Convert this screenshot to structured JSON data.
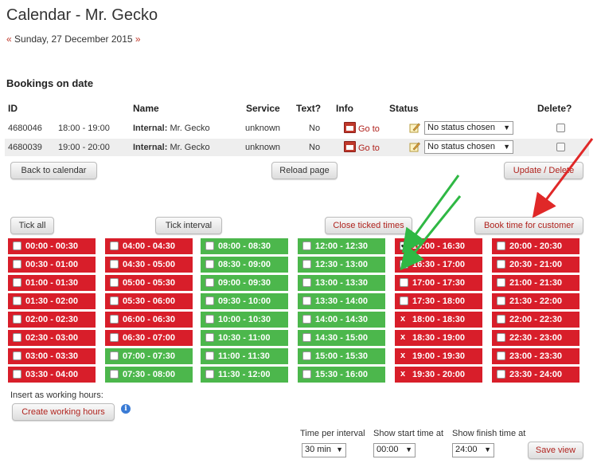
{
  "page": {
    "title": "Calendar - Mr. Gecko",
    "date_prev": "«",
    "date": "Sunday, 27 December 2015",
    "date_next": "»",
    "subtitle": "Bookings on date"
  },
  "table": {
    "headers": {
      "id": "ID",
      "name": "Name",
      "service": "Service",
      "text": "Text?",
      "info": "Info",
      "status": "Status",
      "delete": "Delete?"
    },
    "rows": [
      {
        "id": "4680046",
        "time": "18:00 - 19:00",
        "name_bold": "Internal:",
        "name": "Mr. Gecko",
        "service": "unknown",
        "text": "No",
        "info": "Go to",
        "status": "No status chosen"
      },
      {
        "id": "4680039",
        "time": "19:00 - 20:00",
        "name_bold": "Internal:",
        "name": "Mr. Gecko",
        "service": "unknown",
        "text": "No",
        "info": "Go to",
        "status": "No status chosen"
      }
    ]
  },
  "buttons": {
    "back": "Back to calendar",
    "reload": "Reload page",
    "update": "Update / Delete",
    "tick_all": "Tick all",
    "tick_interval": "Tick interval",
    "close_ticked": "Close ticked times",
    "book_time": "Book time for customer",
    "create_working": "Create working hours",
    "save_view": "Save view"
  },
  "slots": {
    "col1": [
      {
        "t": "00:00 - 00:30",
        "s": "closed"
      },
      {
        "t": "00:30 - 01:00",
        "s": "closed"
      },
      {
        "t": "01:00 - 01:30",
        "s": "closed"
      },
      {
        "t": "01:30 - 02:00",
        "s": "closed"
      },
      {
        "t": "02:00 - 02:30",
        "s": "closed"
      },
      {
        "t": "02:30 - 03:00",
        "s": "closed"
      },
      {
        "t": "03:00 - 03:30",
        "s": "closed"
      },
      {
        "t": "03:30 - 04:00",
        "s": "closed"
      }
    ],
    "col2": [
      {
        "t": "04:00 - 04:30",
        "s": "closed"
      },
      {
        "t": "04:30 - 05:00",
        "s": "closed"
      },
      {
        "t": "05:00 - 05:30",
        "s": "closed"
      },
      {
        "t": "05:30 - 06:00",
        "s": "closed"
      },
      {
        "t": "06:00 - 06:30",
        "s": "closed"
      },
      {
        "t": "06:30 - 07:00",
        "s": "closed"
      },
      {
        "t": "07:00 - 07:30",
        "s": "open"
      },
      {
        "t": "07:30 - 08:00",
        "s": "open"
      }
    ],
    "col3": [
      {
        "t": "08:00 - 08:30",
        "s": "open"
      },
      {
        "t": "08:30 - 09:00",
        "s": "open"
      },
      {
        "t": "09:00 - 09:30",
        "s": "open"
      },
      {
        "t": "09:30 - 10:00",
        "s": "open"
      },
      {
        "t": "10:00 - 10:30",
        "s": "open"
      },
      {
        "t": "10:30 - 11:00",
        "s": "open"
      },
      {
        "t": "11:00 - 11:30",
        "s": "open"
      },
      {
        "t": "11:30 - 12:00",
        "s": "open"
      }
    ],
    "col4": [
      {
        "t": "12:00 - 12:30",
        "s": "open"
      },
      {
        "t": "12:30 - 13:00",
        "s": "open"
      },
      {
        "t": "13:00 - 13:30",
        "s": "open"
      },
      {
        "t": "13:30 - 14:00",
        "s": "open"
      },
      {
        "t": "14:00 - 14:30",
        "s": "open"
      },
      {
        "t": "14:30 - 15:00",
        "s": "open"
      },
      {
        "t": "15:00 - 15:30",
        "s": "open"
      },
      {
        "t": "15:30 - 16:00",
        "s": "open"
      }
    ],
    "col5": [
      {
        "t": "16:00 - 16:30",
        "s": "checked"
      },
      {
        "t": "16:30 - 17:00",
        "s": "checked"
      },
      {
        "t": "17:00 - 17:30",
        "s": "closed"
      },
      {
        "t": "17:30 - 18:00",
        "s": "closed"
      },
      {
        "t": "18:00 - 18:30",
        "s": "booked"
      },
      {
        "t": "18:30 - 19:00",
        "s": "booked"
      },
      {
        "t": "19:00 - 19:30",
        "s": "booked"
      },
      {
        "t": "19:30 - 20:00",
        "s": "booked"
      }
    ],
    "col6": [
      {
        "t": "20:00 - 20:30",
        "s": "closed"
      },
      {
        "t": "20:30 - 21:00",
        "s": "closed"
      },
      {
        "t": "21:00 - 21:30",
        "s": "closed"
      },
      {
        "t": "21:30 - 22:00",
        "s": "closed"
      },
      {
        "t": "22:00 - 22:30",
        "s": "closed"
      },
      {
        "t": "22:30 - 23:00",
        "s": "closed"
      },
      {
        "t": "23:00 - 23:30",
        "s": "closed"
      },
      {
        "t": "23:30 - 24:00",
        "s": "closed"
      }
    ]
  },
  "booked_mark": "x",
  "working_label": "Insert as working hours:",
  "view": {
    "interval_label": "Time per interval",
    "interval_value": "30 min",
    "start_label": "Show start time at",
    "start_value": "00:00",
    "finish_label": "Show finish time at",
    "finish_value": "24:00"
  },
  "colors": {
    "closed": "#d81e2a",
    "open": "#4cb74c",
    "arrow_green": "#2fb844",
    "arrow_red": "#e02828"
  }
}
